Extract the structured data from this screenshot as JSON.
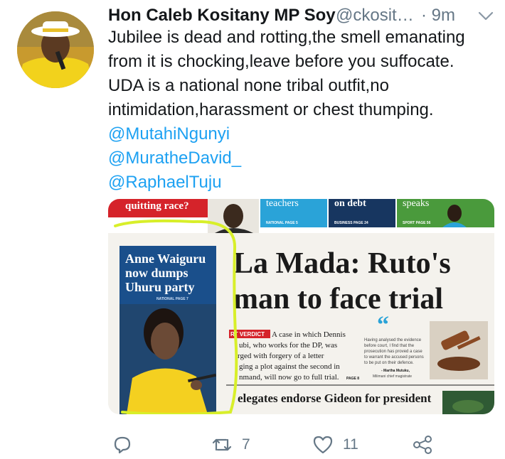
{
  "tweet": {
    "author_name": "Hon Caleb Kositany MP Soy",
    "handle": "@ckosit…",
    "time": "· 9m",
    "text_lines": [
      "Jubilee is dead and rotting,the smell emanating",
      "from it is chocking,leave before you suffocate.",
      "UDA is a national none tribal outfit,no",
      "intimidation,harassment or chest thumping."
    ],
    "mentions": [
      "@MutahiNgunyi",
      "@MuratheDavid_",
      "@RaphaelTuju"
    ],
    "retweet_count": "7",
    "like_count": "11"
  },
  "newspaper": {
    "top_strip": {
      "left_text": "quitting race?",
      "box1_title": "teachers",
      "box1_ref": "NATIONAL PAGE 5",
      "box2_title": "on debt",
      "box2_ref": "BUSINESS PAGE 24",
      "box3_title": "speaks",
      "box3_ref": "SPORT PAGE 56"
    },
    "sidebar_headline": [
      "Anne Waiguru",
      "now dumps",
      "Uhuru party"
    ],
    "sidebar_ref": "NATIONAL PAGE 7",
    "main_headline": [
      "La Mada: Ruto's",
      "man to face trial"
    ],
    "kicker": "RT VERDICT",
    "story_lines": [
      "A case in which Dennis",
      "ubi, who works for the DP, was",
      "rged with forgery of a letter",
      "ging a plot against the second in",
      "nmand, will now go to full trial."
    ],
    "story_ref": "PAGE 8",
    "quote_lines": [
      "Having analysed the evidence",
      "before court, I find that the",
      "prosecution has proved a case",
      "to warrant the accused persons",
      "to be put on their defence."
    ],
    "quote_attribution": "- Martha Mutuku,",
    "quote_attribution_role": "Milimani chief magistrate",
    "bottom_headline": "elegates endorse Gideon for president"
  },
  "colors": {
    "link": "#1da1f2",
    "secondary": "#657786",
    "highlighter": "#d8ef2a",
    "paper_red": "#d5232a",
    "paper_blue": "#1a4f8b",
    "paper_navy": "#173660",
    "paper_cyan": "#2aa3d8",
    "paper_green": "#4a9a3c"
  },
  "icons": {
    "avatar": "profile-photo",
    "more": "chevron-down-icon",
    "reply": "reply-icon",
    "retweet": "retweet-icon",
    "like": "heart-icon",
    "share": "share-icon",
    "quote": "quote-mark-icon"
  }
}
